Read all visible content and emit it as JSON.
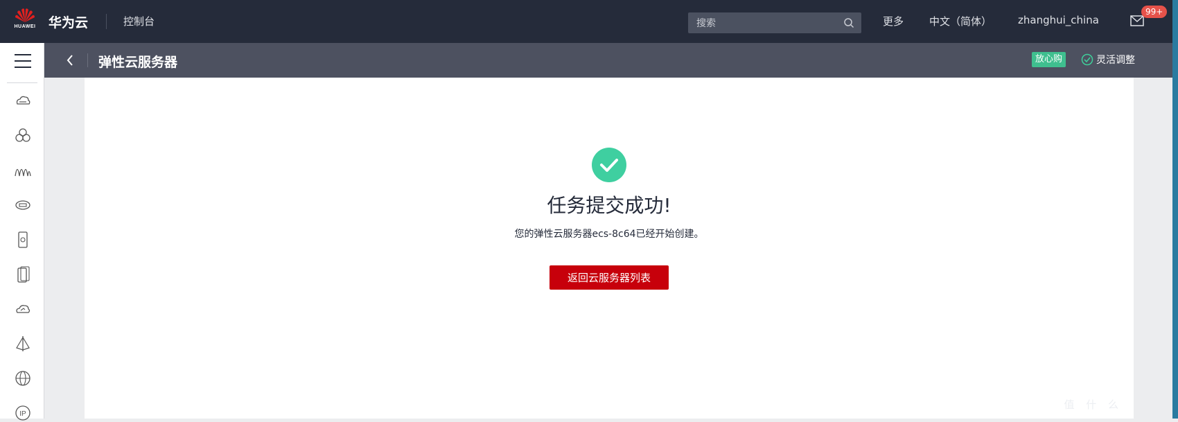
{
  "header": {
    "logo_text": "HUAWEI",
    "brand": "华为云",
    "console": "控制台",
    "search_placeholder": "搜索",
    "more": "更多",
    "language": "中文（简体）",
    "username": "zhanghui_china",
    "mail_badge": "99+"
  },
  "sidebar": {
    "icons": [
      "cloud-server-icon",
      "cluster-icon",
      "waveform-icon",
      "disk-icon",
      "mobile-device-icon",
      "phone-copy-icon",
      "cloud-link-icon",
      "network-node-icon",
      "globe-icon",
      "ip-icon"
    ]
  },
  "subheader": {
    "title": "弹性云服务器",
    "tag": "放心购",
    "flex_adjust": "灵活调整"
  },
  "result": {
    "title": "任务提交成功!",
    "description": "您的弹性云服务器ecs-8c64已经开始创建。",
    "button": "返回云服务器列表"
  },
  "watermark": "值 什 么",
  "colors": {
    "topbar": "#252b3a",
    "subheader": "#4d5160",
    "primary_button": "#c7000b",
    "success": "#3fcfa0",
    "badge": "#e6524a"
  }
}
